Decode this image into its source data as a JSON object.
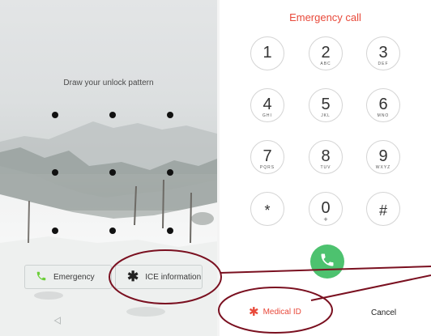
{
  "lock_screen": {
    "title": "Draw your unlock pattern",
    "emergency_label": "Emergency",
    "ice_label": "ICE information",
    "icons": {
      "phone": "phone-icon",
      "ice": "asterisk-icon",
      "back": "back-triangle-icon"
    }
  },
  "dialer": {
    "title": "Emergency call",
    "keys": [
      {
        "digit": "1",
        "letters": ""
      },
      {
        "digit": "2",
        "letters": "ABC"
      },
      {
        "digit": "3",
        "letters": "DEF"
      },
      {
        "digit": "4",
        "letters": "GHI"
      },
      {
        "digit": "5",
        "letters": "JKL"
      },
      {
        "digit": "6",
        "letters": "MNO"
      },
      {
        "digit": "7",
        "letters": "PQRS"
      },
      {
        "digit": "8",
        "letters": "TUV"
      },
      {
        "digit": "9",
        "letters": "WXYZ"
      },
      {
        "digit": "*",
        "letters": ""
      },
      {
        "digit": "0",
        "letters": "+"
      },
      {
        "digit": "#",
        "letters": ""
      }
    ],
    "call_icon": "phone-icon",
    "medical_label": "Medical ID",
    "cancel_label": "Cancel"
  },
  "colors": {
    "accent_red": "#e8493a",
    "call_green": "#4dc26f",
    "annotation": "#7a1020",
    "emergency_icon_green": "#6ccf3a"
  }
}
